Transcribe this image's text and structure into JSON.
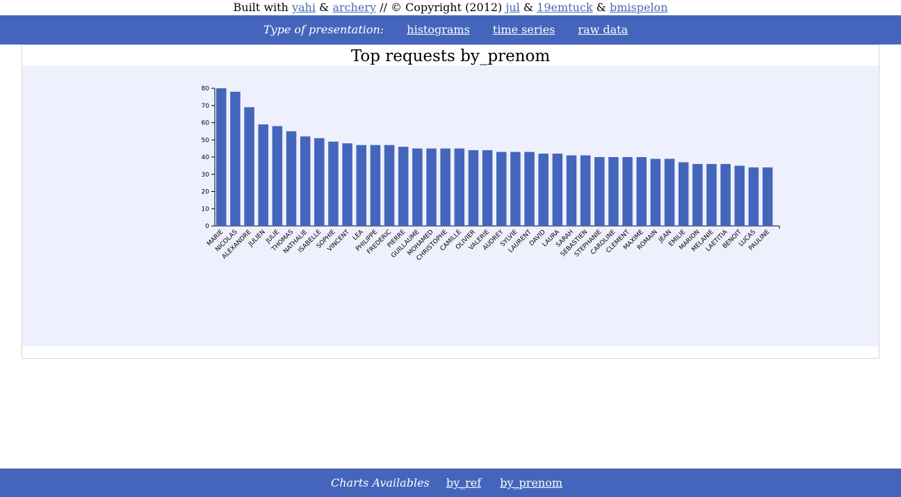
{
  "header": {
    "built_with": "Built with",
    "link_yahi": "yahi",
    "amp1": "&",
    "link_archery": "archery",
    "copyright": "// © Copyright (2012)",
    "link_jul": "jul",
    "amp2": "&",
    "link_19emtuck": "19emtuck",
    "amp3": "&",
    "link_bmispelon": "bmispelon"
  },
  "nav": {
    "label": "Type of presentation:",
    "items": [
      "histograms",
      "time series",
      "raw data"
    ]
  },
  "panel": {
    "title": "Top requests by_prenom"
  },
  "footer": {
    "label": "Charts Availables",
    "links": [
      "by_ref",
      "by_prenom"
    ]
  },
  "colors": {
    "bar": "#4465bb",
    "nav_bg": "#4465bb",
    "chart_bg": "#eef0fd"
  },
  "chart_data": {
    "type": "bar",
    "title": "Top requests by_prenom",
    "xlabel": "",
    "ylabel": "",
    "ylim": [
      0,
      80
    ],
    "yticks": [
      0,
      10,
      20,
      30,
      40,
      50,
      60,
      70,
      80
    ],
    "categories": [
      "MARIE",
      "NICOLAS",
      "ALEXANDRE",
      "JULIEN",
      "JULIE",
      "THOMAS",
      "NATHALIE",
      "ISABELLE",
      "SOPHIE",
      "VINCENT",
      "LEA",
      "PHILIPPE",
      "FREDERIC",
      "PIERRE",
      "GUILLAUME",
      "MOHAMED",
      "CHRISTOPHE",
      "CAMILLE",
      "OLIVIER",
      "VALERIE",
      "AUDREY",
      "SYLVIE",
      "LAURENT",
      "DAVID",
      "LAURA",
      "SARAH",
      "SEBASTIEN",
      "STEPHANIE",
      "CAROLINE",
      "CLEMENT",
      "MAXIME",
      "ROMAIN",
      "JEAN",
      "EMILIE",
      "MARION",
      "MELANIE",
      "LAETITIA",
      "BENOIT",
      "LUCAS",
      "PAULINE"
    ],
    "values": [
      80,
      78,
      69,
      59,
      58,
      55,
      52,
      51,
      49,
      48,
      47,
      47,
      47,
      46,
      45,
      45,
      45,
      45,
      44,
      44,
      43,
      43,
      43,
      42,
      42,
      41,
      41,
      40,
      40,
      40,
      40,
      39,
      39,
      37,
      36,
      36,
      36,
      35,
      34,
      34
    ],
    "grid": false,
    "legend": "none"
  }
}
